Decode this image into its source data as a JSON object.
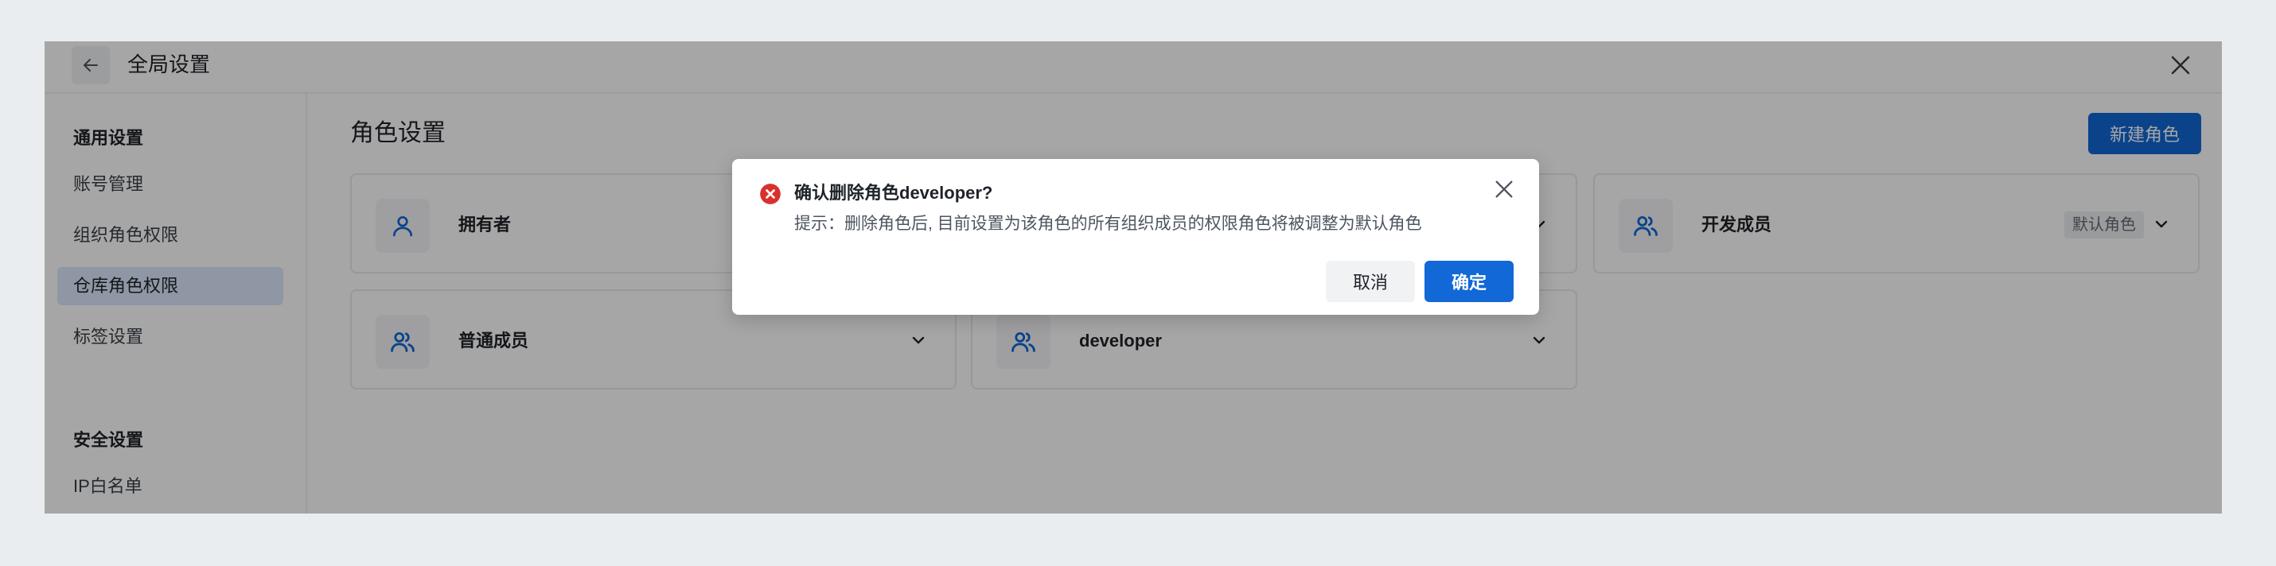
{
  "header": {
    "title": "全局设置"
  },
  "sidebar": {
    "groups": [
      {
        "label": "通用设置",
        "items": [
          {
            "label": "账号管理"
          },
          {
            "label": "组织角色权限"
          },
          {
            "label": "仓库角色权限",
            "active": true
          },
          {
            "label": "标签设置"
          }
        ]
      },
      {
        "label": "安全设置",
        "items": [
          {
            "label": "IP白名单"
          }
        ]
      }
    ]
  },
  "main": {
    "title": "角色设置",
    "new_role_label": "新建角色",
    "roles": [
      {
        "name": "拥有者",
        "icon": "user-icon"
      },
      {
        "name": "",
        "icon": "users-icon"
      },
      {
        "name": "开发成员",
        "icon": "users-icon",
        "badge": "默认角色"
      },
      {
        "name": "普通成员",
        "icon": "users-icon"
      },
      {
        "name": "developer",
        "icon": "users-icon"
      }
    ]
  },
  "modal": {
    "title": "确认删除角色developer?",
    "text": "提示：删除角色后, 目前设置为该角色的所有组织成员的权限角色将被调整为默认角色",
    "cancel_label": "取消",
    "confirm_label": "确定"
  },
  "colors": {
    "primary": "#1168d6",
    "error": "#d9302c",
    "active_bg": "#dbe9fa"
  }
}
